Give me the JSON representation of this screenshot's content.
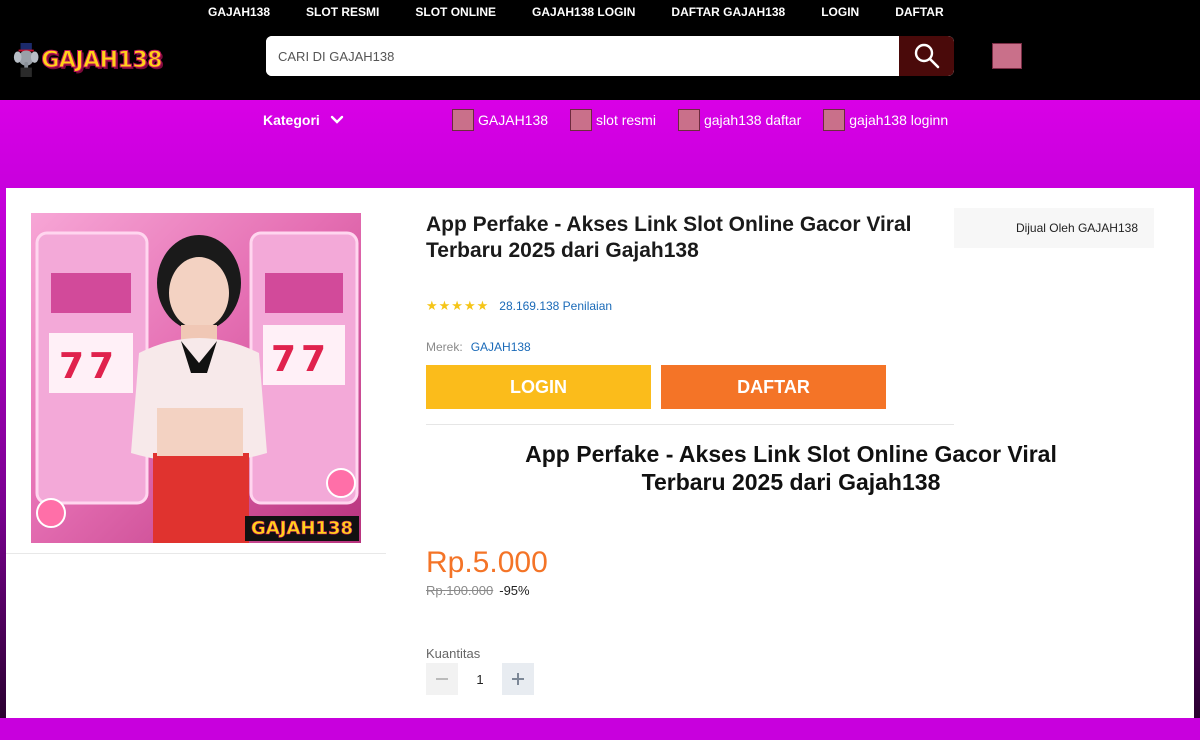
{
  "topnav": [
    "GAJAH138",
    "SLOT RESMI",
    "SLOT ONLINE",
    "GAJAH138 LOGIN",
    "DAFTAR GAJAH138",
    "LOGIN",
    "DAFTAR"
  ],
  "brand": {
    "logo_text": "GAJAH138"
  },
  "search": {
    "placeholder": "CARI DI GAJAH138",
    "icon": "search-icon"
  },
  "categories": {
    "label": "Kategori",
    "links": [
      "GAJAH138",
      "slot resmi",
      "gajah138 daftar",
      "gajah138 loginn"
    ]
  },
  "product": {
    "title": "App Perfake - Akses Link Slot Online Gacor Viral Terbaru 2025 dari Gajah138",
    "image_watermark": "GAJAH138",
    "seller": "Dijual Oleh GAJAH138",
    "stars": "★★★★★",
    "rating_count": "28.169.138 Penilaian",
    "brand_label": "Merek:",
    "brand_value": "GAJAH138",
    "login_button": "LOGIN",
    "daftar_button": "DAFTAR",
    "subtitle": "App Perfake - Akses Link Slot Online Gacor Viral Terbaru 2025 dari Gajah138",
    "price": "Rp.5.000",
    "old_price": "Rp.100.000",
    "discount": "-95%",
    "quantity_label": "Kuantitas",
    "quantity": "1"
  },
  "colors": {
    "header_bg": "#000000",
    "category_band": "#d900e6",
    "login_button": "#fbbc1b",
    "daftar_button": "#f47427",
    "price": "#f47427",
    "link": "#1a6ab8"
  }
}
